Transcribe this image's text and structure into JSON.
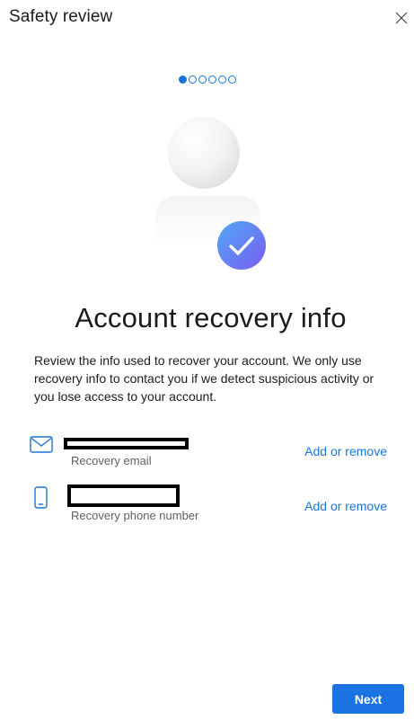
{
  "header": {
    "title": "Safety review",
    "close_icon": "close-icon"
  },
  "pager": {
    "total_steps": 6,
    "current_step": 1,
    "active_color": "#1a73d9"
  },
  "illustration": {
    "icon": "user-silhouette-icon",
    "badge_icon": "check-circle-icon",
    "badge_gradient": [
      "#4fa8f7",
      "#7a5cf0"
    ]
  },
  "main": {
    "title": "Account recovery info",
    "description": "Review the info used to recover your account. We only use recovery info to contact you if we detect suspicious activity or you lose access to your account."
  },
  "recovery_items": [
    {
      "icon": "mail-icon",
      "value_redacted": true,
      "label": "Recovery email",
      "action": "Add or remove"
    },
    {
      "icon": "phone-icon",
      "value_redacted": true,
      "label": "Recovery phone number",
      "action": "Add or remove"
    }
  ],
  "footer": {
    "next_label": "Next",
    "accent_color": "#1a73e0"
  }
}
